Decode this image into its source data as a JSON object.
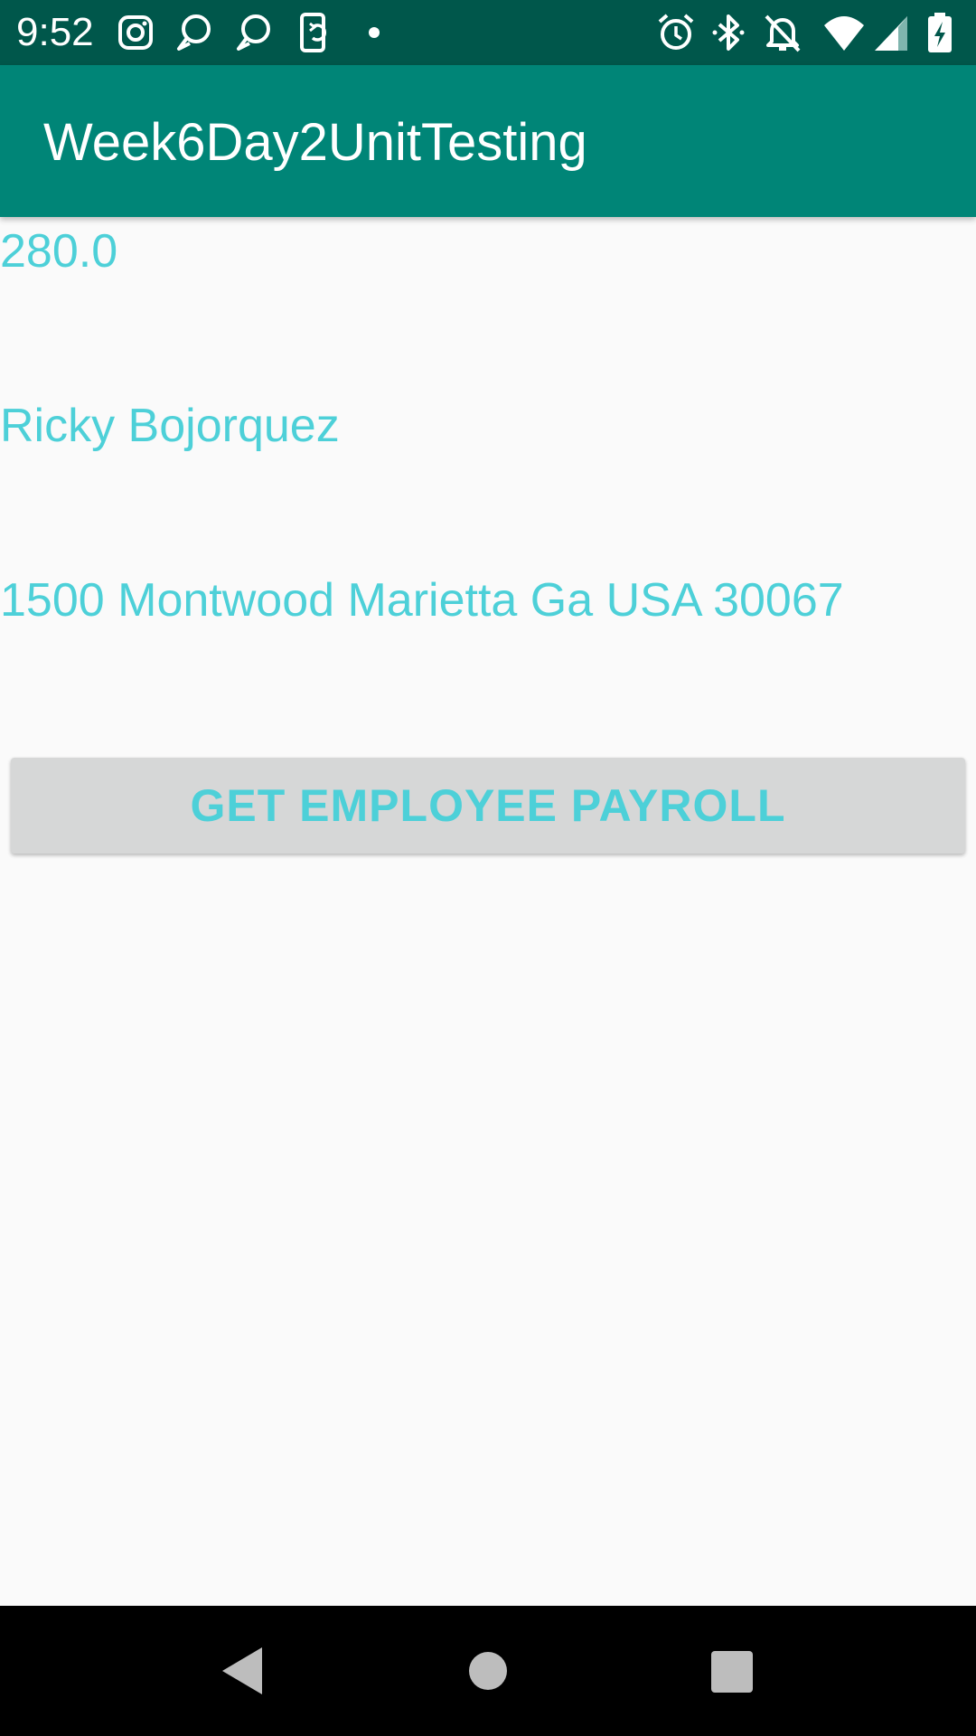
{
  "status_bar": {
    "time": "9:52",
    "background": "#00574B",
    "notification_icons": [
      "instagram-icon",
      "chat-bubble-icon",
      "chat-bubble-icon",
      "phone-sync-icon",
      "dot-icon"
    ],
    "system_icons": [
      "alarm-icon",
      "bluetooth-icon",
      "notifications-off-icon",
      "wifi-icon",
      "cellular-signal-icon",
      "battery-charging-icon"
    ]
  },
  "app_bar": {
    "title": "Week6Day2UnitTesting",
    "background": "#008577"
  },
  "content": {
    "pay_amount": "280.0",
    "employee_name": "Ricky Bojorquez",
    "employee_address": "1500 Montwood Marietta Ga USA 30067",
    "text_color": "#4DD0D8"
  },
  "button": {
    "label": "GET EMPLOYEE PAYROLL",
    "background": "#D6D7D7"
  },
  "nav_bar": {
    "buttons": [
      "back-icon",
      "home-icon",
      "recents-icon"
    ]
  }
}
